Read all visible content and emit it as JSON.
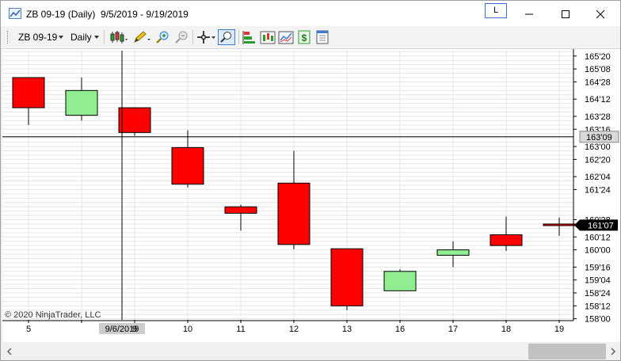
{
  "window": {
    "title": "ZB 09-19 (Daily)  9/5/2019 - 9/19/2019",
    "link_button_label": "L"
  },
  "toolbar": {
    "instrument": "ZB 09-19",
    "interval": "Daily",
    "icons": [
      "bar-style-icon",
      "drawing-tools-icon",
      "zoom-in-icon",
      "zoom-out-icon",
      "crosshair-icon",
      "magnifier-icon",
      "strategy-icon",
      "indicators-icon",
      "chart-trader-icon",
      "dollar-icon",
      "properties-icon"
    ]
  },
  "chart_data": {
    "type": "candlestick",
    "x": [
      "5",
      "9/6/2019",
      "9",
      "10",
      "11",
      "12",
      "13",
      "16",
      "17",
      "18",
      "19"
    ],
    "ohlc": [
      {
        "open": 165.0,
        "high": 165.0,
        "low": 163.625,
        "close": 164.125
      },
      {
        "open": 163.90625,
        "high": 165.0,
        "low": 163.75,
        "close": 164.625
      },
      {
        "open": 164.125,
        "high": 164.125,
        "low": 163.3125,
        "close": 163.40625
      },
      {
        "open": 162.96875,
        "high": 163.46875,
        "low": 161.8125,
        "close": 161.90625
      },
      {
        "open": 161.25,
        "high": 161.3125,
        "low": 160.5625,
        "close": 161.0625
      },
      {
        "open": 161.9375,
        "high": 162.875,
        "low": 160.015625,
        "close": 160.15625
      },
      {
        "open": 160.03125,
        "high": 160.03125,
        "low": 158.25,
        "close": 158.375
      },
      {
        "open": 158.8125,
        "high": 159.4375,
        "low": 158.8125,
        "close": 159.375
      },
      {
        "open": 159.84375,
        "high": 160.25,
        "low": 159.5,
        "close": 160.0
      },
      {
        "open": 160.4375,
        "high": 160.96875,
        "low": 159.96875,
        "close": 160.125
      },
      {
        "open": 160.75,
        "high": 160.9375,
        "low": 160.40625,
        "close": 160.71875
      }
    ],
    "y_tick_labels": [
      "165'20",
      "165'08",
      "164'28",
      "164'12",
      "163'28",
      "163'16",
      "163'00",
      "162'20",
      "162'04",
      "161'24",
      "160'28",
      "160'12",
      "160'00",
      "159'16",
      "159'04",
      "158'24",
      "158'12",
      "158'00"
    ],
    "y_ticks": [
      165.625,
      165.25,
      164.875,
      164.375,
      163.875,
      163.5,
      163.0,
      162.625,
      162.125,
      161.75,
      160.875,
      160.375,
      160.0,
      159.5,
      159.125,
      158.75,
      158.375,
      158.0
    ],
    "ylim": [
      157.96875,
      165.78125
    ],
    "crosshair_price_label": "163'09",
    "crosshair_price": 163.28125,
    "crosshair_index": 1,
    "last_price_label": "161'07",
    "last_price": 160.71875,
    "copyright": "© 2020 NinjaTrader, LLC",
    "colors": {
      "up": "#90ee90",
      "down": "#ff0000",
      "grid": "#e6e6e6",
      "wick": "#000000"
    }
  }
}
